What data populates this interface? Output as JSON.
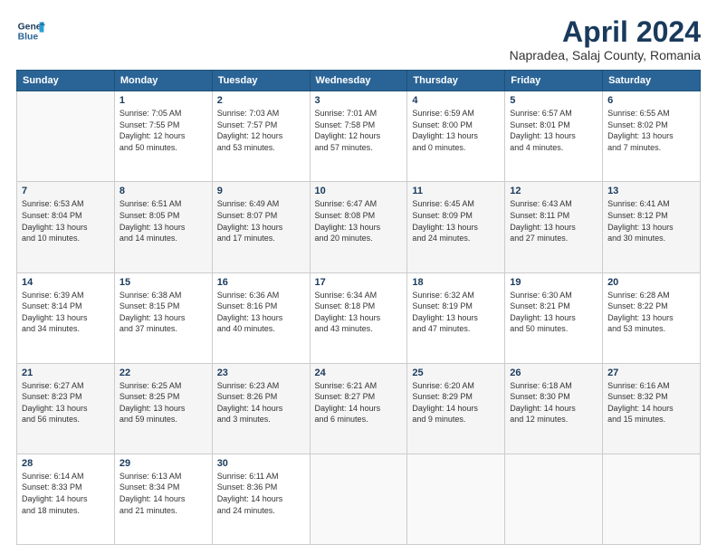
{
  "header": {
    "logo_line1": "General",
    "logo_line2": "Blue",
    "month": "April 2024",
    "location": "Napradea, Salaj County, Romania"
  },
  "weekdays": [
    "Sunday",
    "Monday",
    "Tuesday",
    "Wednesday",
    "Thursday",
    "Friday",
    "Saturday"
  ],
  "weeks": [
    [
      {
        "day": "",
        "info": ""
      },
      {
        "day": "1",
        "info": "Sunrise: 7:05 AM\nSunset: 7:55 PM\nDaylight: 12 hours\nand 50 minutes."
      },
      {
        "day": "2",
        "info": "Sunrise: 7:03 AM\nSunset: 7:57 PM\nDaylight: 12 hours\nand 53 minutes."
      },
      {
        "day": "3",
        "info": "Sunrise: 7:01 AM\nSunset: 7:58 PM\nDaylight: 12 hours\nand 57 minutes."
      },
      {
        "day": "4",
        "info": "Sunrise: 6:59 AM\nSunset: 8:00 PM\nDaylight: 13 hours\nand 0 minutes."
      },
      {
        "day": "5",
        "info": "Sunrise: 6:57 AM\nSunset: 8:01 PM\nDaylight: 13 hours\nand 4 minutes."
      },
      {
        "day": "6",
        "info": "Sunrise: 6:55 AM\nSunset: 8:02 PM\nDaylight: 13 hours\nand 7 minutes."
      }
    ],
    [
      {
        "day": "7",
        "info": "Sunrise: 6:53 AM\nSunset: 8:04 PM\nDaylight: 13 hours\nand 10 minutes."
      },
      {
        "day": "8",
        "info": "Sunrise: 6:51 AM\nSunset: 8:05 PM\nDaylight: 13 hours\nand 14 minutes."
      },
      {
        "day": "9",
        "info": "Sunrise: 6:49 AM\nSunset: 8:07 PM\nDaylight: 13 hours\nand 17 minutes."
      },
      {
        "day": "10",
        "info": "Sunrise: 6:47 AM\nSunset: 8:08 PM\nDaylight: 13 hours\nand 20 minutes."
      },
      {
        "day": "11",
        "info": "Sunrise: 6:45 AM\nSunset: 8:09 PM\nDaylight: 13 hours\nand 24 minutes."
      },
      {
        "day": "12",
        "info": "Sunrise: 6:43 AM\nSunset: 8:11 PM\nDaylight: 13 hours\nand 27 minutes."
      },
      {
        "day": "13",
        "info": "Sunrise: 6:41 AM\nSunset: 8:12 PM\nDaylight: 13 hours\nand 30 minutes."
      }
    ],
    [
      {
        "day": "14",
        "info": "Sunrise: 6:39 AM\nSunset: 8:14 PM\nDaylight: 13 hours\nand 34 minutes."
      },
      {
        "day": "15",
        "info": "Sunrise: 6:38 AM\nSunset: 8:15 PM\nDaylight: 13 hours\nand 37 minutes."
      },
      {
        "day": "16",
        "info": "Sunrise: 6:36 AM\nSunset: 8:16 PM\nDaylight: 13 hours\nand 40 minutes."
      },
      {
        "day": "17",
        "info": "Sunrise: 6:34 AM\nSunset: 8:18 PM\nDaylight: 13 hours\nand 43 minutes."
      },
      {
        "day": "18",
        "info": "Sunrise: 6:32 AM\nSunset: 8:19 PM\nDaylight: 13 hours\nand 47 minutes."
      },
      {
        "day": "19",
        "info": "Sunrise: 6:30 AM\nSunset: 8:21 PM\nDaylight: 13 hours\nand 50 minutes."
      },
      {
        "day": "20",
        "info": "Sunrise: 6:28 AM\nSunset: 8:22 PM\nDaylight: 13 hours\nand 53 minutes."
      }
    ],
    [
      {
        "day": "21",
        "info": "Sunrise: 6:27 AM\nSunset: 8:23 PM\nDaylight: 13 hours\nand 56 minutes."
      },
      {
        "day": "22",
        "info": "Sunrise: 6:25 AM\nSunset: 8:25 PM\nDaylight: 13 hours\nand 59 minutes."
      },
      {
        "day": "23",
        "info": "Sunrise: 6:23 AM\nSunset: 8:26 PM\nDaylight: 14 hours\nand 3 minutes."
      },
      {
        "day": "24",
        "info": "Sunrise: 6:21 AM\nSunset: 8:27 PM\nDaylight: 14 hours\nand 6 minutes."
      },
      {
        "day": "25",
        "info": "Sunrise: 6:20 AM\nSunset: 8:29 PM\nDaylight: 14 hours\nand 9 minutes."
      },
      {
        "day": "26",
        "info": "Sunrise: 6:18 AM\nSunset: 8:30 PM\nDaylight: 14 hours\nand 12 minutes."
      },
      {
        "day": "27",
        "info": "Sunrise: 6:16 AM\nSunset: 8:32 PM\nDaylight: 14 hours\nand 15 minutes."
      }
    ],
    [
      {
        "day": "28",
        "info": "Sunrise: 6:14 AM\nSunset: 8:33 PM\nDaylight: 14 hours\nand 18 minutes."
      },
      {
        "day": "29",
        "info": "Sunrise: 6:13 AM\nSunset: 8:34 PM\nDaylight: 14 hours\nand 21 minutes."
      },
      {
        "day": "30",
        "info": "Sunrise: 6:11 AM\nSunset: 8:36 PM\nDaylight: 14 hours\nand 24 minutes."
      },
      {
        "day": "",
        "info": ""
      },
      {
        "day": "",
        "info": ""
      },
      {
        "day": "",
        "info": ""
      },
      {
        "day": "",
        "info": ""
      }
    ]
  ]
}
